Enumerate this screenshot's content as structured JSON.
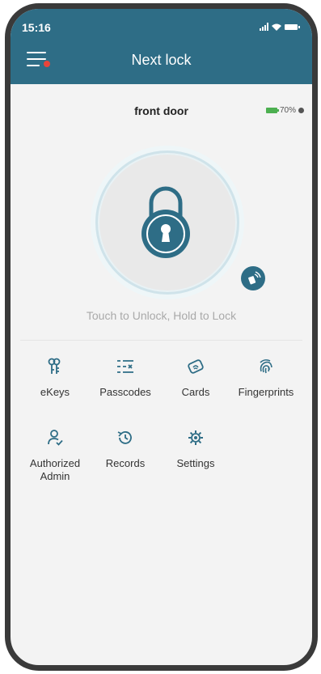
{
  "status_bar": {
    "time": "15:16"
  },
  "header": {
    "title": "Next lock"
  },
  "lock": {
    "name": "front door",
    "battery_text": "70%"
  },
  "hint": "Touch to Unlock, Hold to Lock",
  "menu_items": [
    {
      "label": "eKeys",
      "icon": "key-icon"
    },
    {
      "label": "Passcodes",
      "icon": "passcode-list-icon"
    },
    {
      "label": "Cards",
      "icon": "card-icon"
    },
    {
      "label": "Fingerprints",
      "icon": "fingerprint-icon"
    },
    {
      "label": "Authorized\nAdmin",
      "icon": "admin-user-icon"
    },
    {
      "label": "Records",
      "icon": "history-icon"
    },
    {
      "label": "Settings",
      "icon": "gear-icon"
    }
  ],
  "colors": {
    "brand": "#2e6d86",
    "background": "#f3f3f3",
    "hint": "#a9a9a9",
    "battery": "#4caf50",
    "notification": "#e9443a"
  }
}
